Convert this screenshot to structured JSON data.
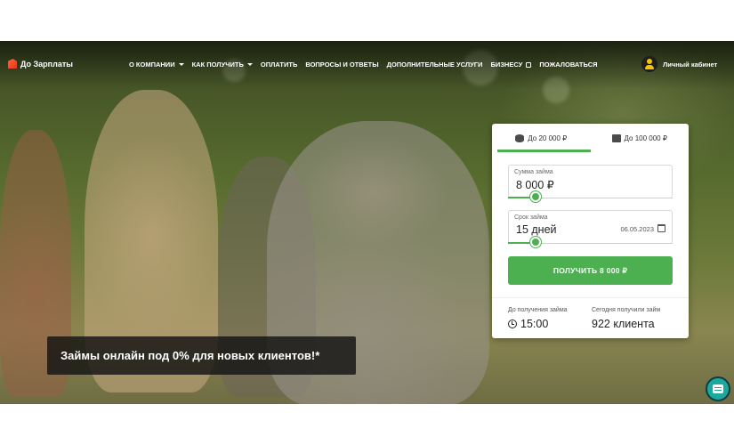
{
  "header": {
    "logo_text": "До Зарплаты",
    "nav": [
      {
        "label": "О КОМПАНИИ",
        "dropdown": true
      },
      {
        "label": "КАК ПОЛУЧИТЬ",
        "dropdown": true
      },
      {
        "label": "ОПЛАТИТЬ",
        "dropdown": false
      },
      {
        "label": "ВОПРОСЫ И ОТВЕТЫ",
        "dropdown": false
      },
      {
        "label": "ДОПОЛНИТЕЛЬНЫЕ УСЛУГИ",
        "dropdown": false
      },
      {
        "label": "БИЗНЕСУ",
        "external": true
      },
      {
        "label": "ПОЖАЛОВАТЬСЯ",
        "dropdown": false
      }
    ],
    "cabinet_label": "Личный кабинет"
  },
  "hero": {
    "banner_text": "Займы онлайн под 0% для новых клиентов!*"
  },
  "calculator": {
    "tabs": [
      {
        "label": "До 20 000 ₽",
        "icon": "coins-icon",
        "active": true
      },
      {
        "label": "До 100 000 ₽",
        "icon": "wallet-icon",
        "active": false
      }
    ],
    "amount": {
      "label": "Сумма займа",
      "value": "8 000 ₽",
      "slider_fraction": 0.17
    },
    "term": {
      "label": "Срок займа",
      "value": "15 дней",
      "date": "06.05.2023",
      "slider_fraction": 0.17
    },
    "submit_label": "ПОЛУЧИТЬ 8 000 ₽",
    "stats": [
      {
        "label": "До получения займа",
        "value": "15:00",
        "icon": "clock-icon"
      },
      {
        "label": "Сегодня получили займ",
        "value": "922 клиента"
      }
    ]
  },
  "colors": {
    "accent": "#4caf50",
    "banner_bg": "#141414",
    "chat": "#1da89e"
  }
}
